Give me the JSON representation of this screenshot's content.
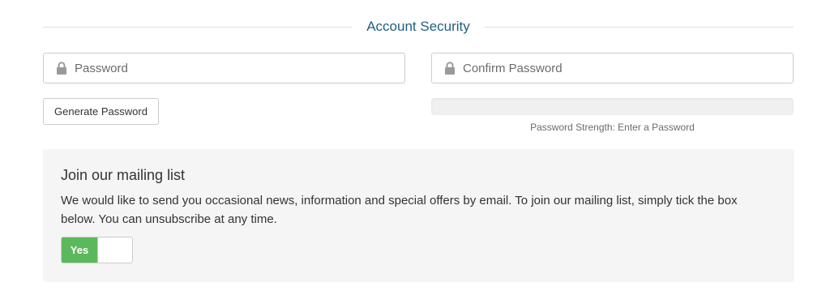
{
  "section": {
    "title": "Account Security"
  },
  "password": {
    "placeholder": "Password",
    "icon": "lock-icon"
  },
  "confirm_password": {
    "placeholder": "Confirm Password",
    "icon": "lock-icon"
  },
  "generate_button": {
    "label": "Generate Password"
  },
  "strength": {
    "label": "Password Strength: Enter a Password",
    "level": 0
  },
  "mailing_list": {
    "title": "Join our mailing list",
    "description": "We would like to send you occasional news, information and special offers by email. To join our mailing list, simply tick the box below. You can unsubscribe at any time.",
    "toggle_label": "Yes",
    "toggle_on": true
  },
  "colors": {
    "heading": "#1f5f82",
    "toggle_on": "#5cb85c",
    "panel_bg": "#f5f5f5"
  }
}
